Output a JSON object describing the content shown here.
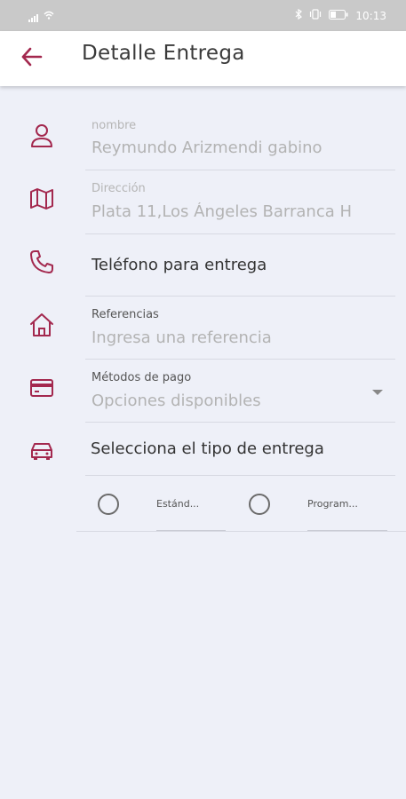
{
  "status_bar": {
    "time": "10:13"
  },
  "header": {
    "title": "Detalle Entrega",
    "back_icon": "arrow-left-icon"
  },
  "form": {
    "nombre": {
      "label": "nombre",
      "value": "Reymundo Arizmendi gabino",
      "icon": "person-icon"
    },
    "direccion": {
      "label": "Dirección",
      "value": "Plata 11,Los Ángeles Barranca H",
      "icon": "map-icon"
    },
    "telefono": {
      "placeholder": "Teléfono para entrega",
      "icon": "phone-icon"
    },
    "referencias": {
      "label": "Referencias",
      "placeholder": "Ingresa una referencia",
      "icon": "home-icon"
    },
    "metodos_pago": {
      "label": "Métodos de pago",
      "placeholder": "Opciones disponibles",
      "icon": "credit-card-icon"
    },
    "tipo_entrega": {
      "label": "Selecciona el tipo de entrega",
      "icon": "car-icon"
    },
    "delivery_options": [
      {
        "label": "Estánd..."
      },
      {
        "label": "Program..."
      }
    ]
  },
  "colors": {
    "accent": "#a3284e",
    "background": "#eef0f8",
    "appbar": "#ffffff"
  }
}
